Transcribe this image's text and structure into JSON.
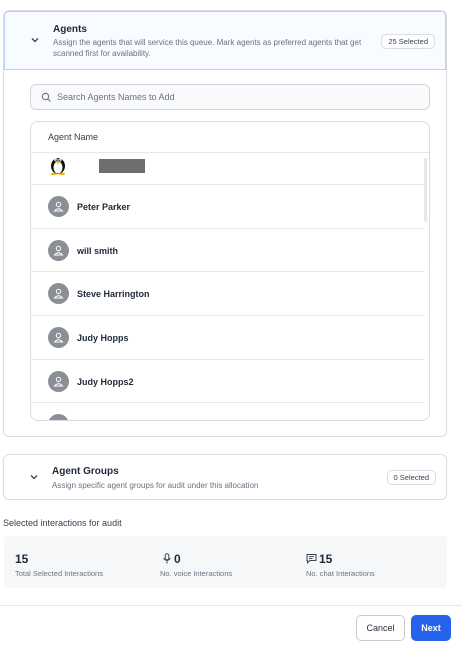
{
  "agents_section": {
    "title": "Agents",
    "description": "Assign the agents that will service this queue. Mark agents as preferred agents that get scanned first for availability.",
    "badge": "25 Selected"
  },
  "search": {
    "placeholder": "Search Agents Names to Add",
    "value": ""
  },
  "table": {
    "header": "Agent Name",
    "rows": [
      {
        "name": "",
        "avatar": "penguin-avatar-icon",
        "redacted": true
      },
      {
        "name": "Peter Parker",
        "avatar": "user-icon"
      },
      {
        "name": "will smith",
        "avatar": "user-icon"
      },
      {
        "name": "Steve Harrington",
        "avatar": "user-icon"
      },
      {
        "name": "Judy Hopps",
        "avatar": "user-icon"
      },
      {
        "name": "Judy Hopps2",
        "avatar": "user-icon"
      }
    ]
  },
  "groups_section": {
    "title": "Agent Groups",
    "description": "Assign specific agent groups for audit under this allocation",
    "badge": "0 Selected"
  },
  "interactions": {
    "heading": "Selected interactions for audit",
    "stats": [
      {
        "value": "15",
        "label": "Total Selected Interactions",
        "icon": ""
      },
      {
        "value": "0",
        "label": "No. voice Interactions",
        "icon": "microphone-icon"
      },
      {
        "value": "15",
        "label": "No. chat Interactions",
        "icon": "chat-icon"
      }
    ]
  },
  "footer": {
    "cancel_label": "Cancel",
    "next_label": "Next"
  },
  "colors": {
    "accent": "#2563eb",
    "header_border": "#b9d3f3",
    "avatar_bg": "#8a8f96"
  }
}
